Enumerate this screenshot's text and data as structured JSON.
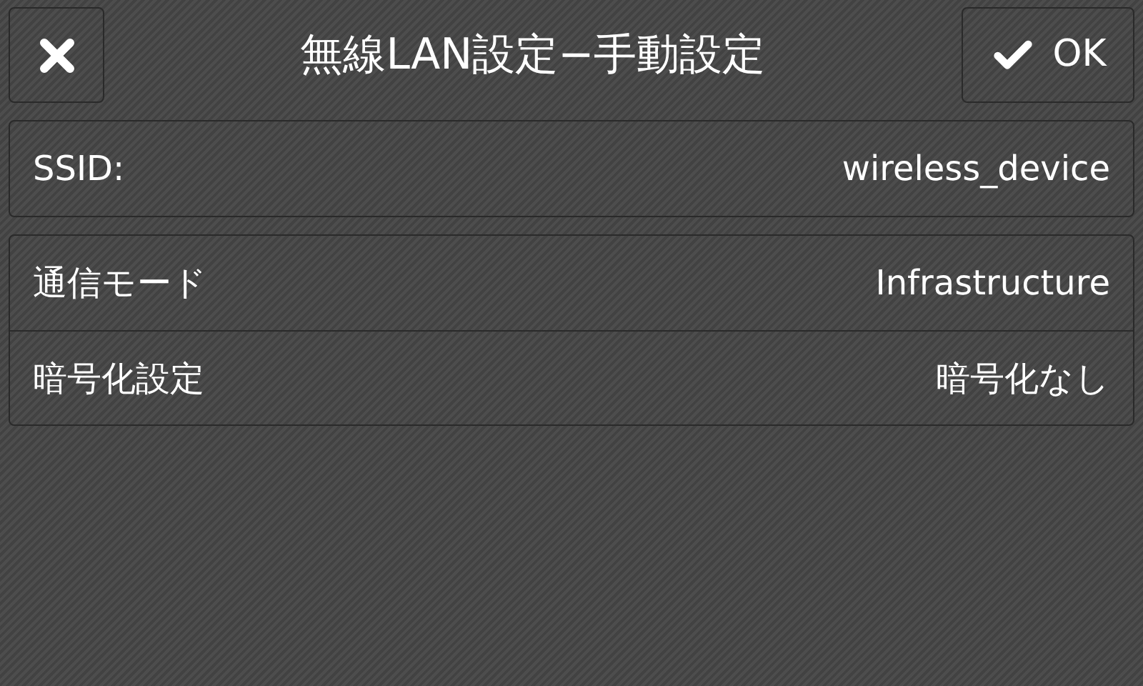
{
  "header": {
    "title": "無線LAN設定−手動設定",
    "ok_label": "OK"
  },
  "groups": [
    {
      "rows": [
        {
          "label": "SSID:",
          "value": "wireless_device"
        }
      ]
    },
    {
      "rows": [
        {
          "label": "通信モード",
          "value": "Infrastructure"
        },
        {
          "label": "暗号化設定",
          "value": "暗号化なし"
        }
      ]
    }
  ]
}
